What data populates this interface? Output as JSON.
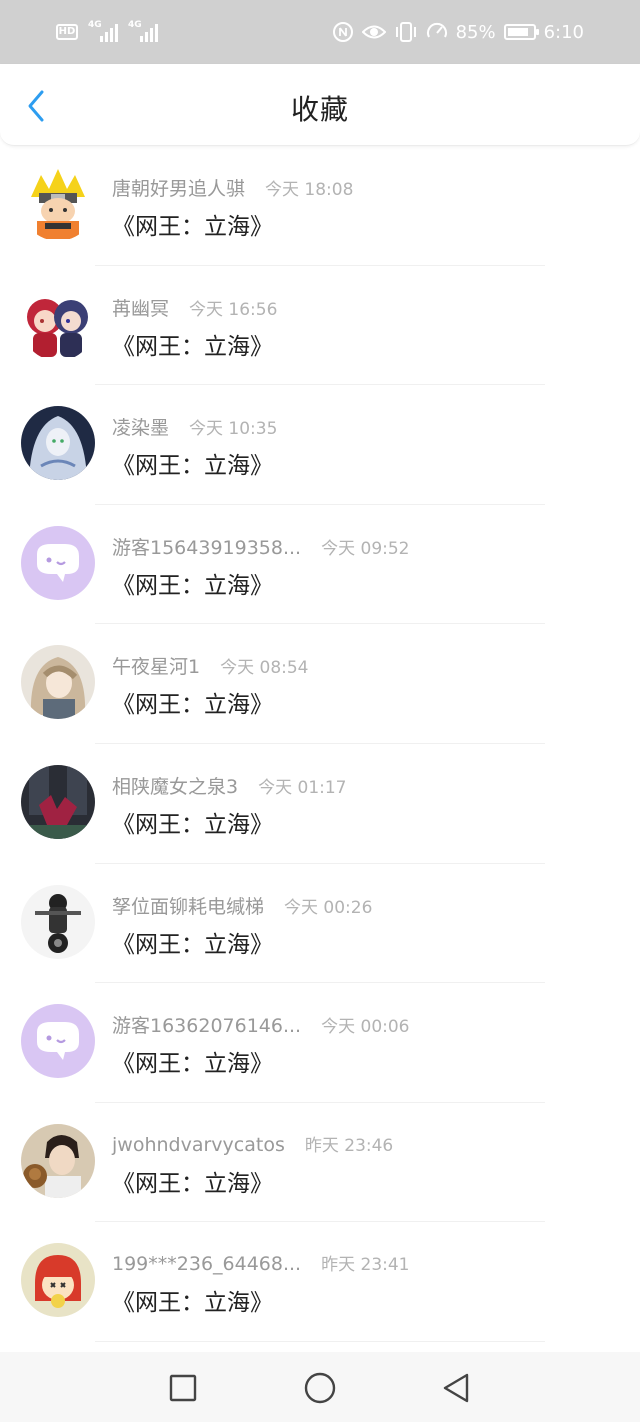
{
  "status_bar": {
    "network_badge": "HD",
    "network_badge_sub": "",
    "signal_1_tag": "4G",
    "signal_2_tag": "4G",
    "battery_percent": "85%",
    "battery_level": 0.85,
    "time": "6:10",
    "icons": [
      "nfc-icon",
      "eye-icon",
      "vibrate-icon",
      "speedometer-icon",
      "battery-icon"
    ]
  },
  "header": {
    "back_icon": "chevron-left-icon",
    "title": "收藏",
    "accent_color": "#2d9df0"
  },
  "favorites": [
    {
      "username": "唐朝好男追人骐",
      "time": "今天 18:08",
      "book": "《网王：立海》",
      "avatar": "anime-ninja-avatar"
    },
    {
      "username": "苒幽冥",
      "time": "今天 16:56",
      "book": "《网王：立海》",
      "avatar": "anime-couple-avatar"
    },
    {
      "username": "凌染墨",
      "time": "今天 10:35",
      "book": "《网王：立海》",
      "avatar": "anime-silver-hair-avatar"
    },
    {
      "username": "游客15643919358...",
      "time": "今天 09:52",
      "book": "《网王：立海》",
      "avatar": "default-chat-avatar"
    },
    {
      "username": "午夜星河1",
      "time": "今天 08:54",
      "book": "《网王：立海》",
      "avatar": "anime-girl-avatar"
    },
    {
      "username": "相陕魔女之泉3",
      "time": "今天 01:17",
      "book": "《网王：立海》",
      "avatar": "dark-photo-avatar"
    },
    {
      "username": "孥位面铆耗电缄梯",
      "time": "今天 00:26",
      "book": "《网王：立海》",
      "avatar": "motorcycle-avatar"
    },
    {
      "username": "游客16362076146...",
      "time": "今天 00:06",
      "book": "《网王：立海》",
      "avatar": "default-chat-avatar"
    },
    {
      "username": "jwohndvarvycatos",
      "time": "昨天 23:46",
      "book": "《网王：立海》",
      "avatar": "photo-boy-avatar"
    },
    {
      "username": "199***236_64468...",
      "time": "昨天 23:41",
      "book": "《网王：立海》",
      "avatar": "cartoon-girl-avatar"
    }
  ],
  "nav_bar": {
    "icons": [
      "recents-square-icon",
      "home-circle-icon",
      "back-triangle-icon"
    ]
  }
}
